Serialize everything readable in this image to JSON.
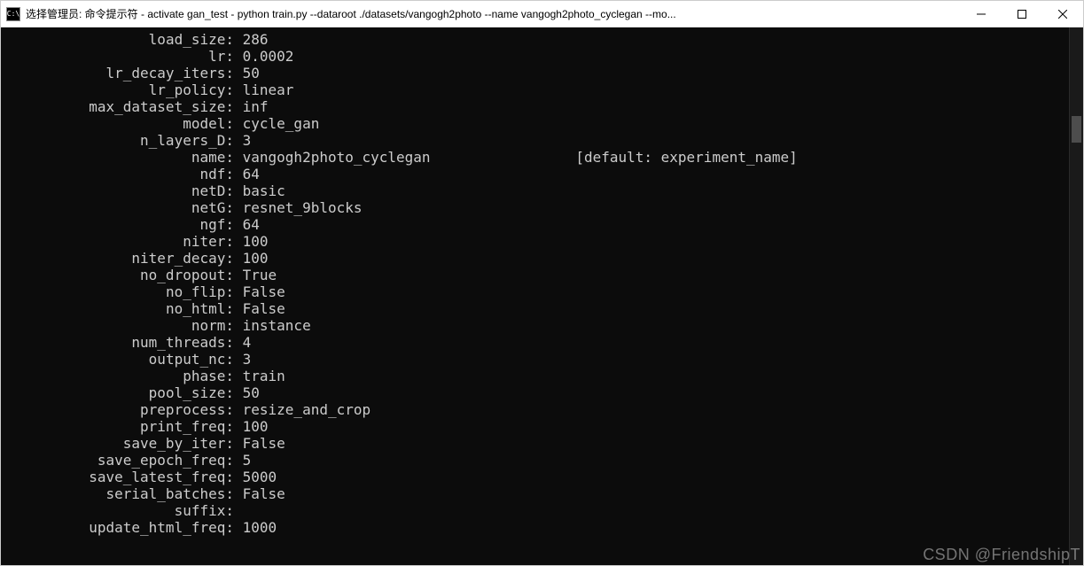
{
  "window": {
    "icon_text": "C:\\",
    "title": "选择管理员: 命令提示符 - activate  gan_test - python  train.py --dataroot ./datasets/vangogh2photo --name vangogh2photo_cyclegan --mo..."
  },
  "terminal": {
    "params": [
      {
        "key": "load_size",
        "value": "286",
        "extra": ""
      },
      {
        "key": "lr",
        "value": "0.0002",
        "extra": ""
      },
      {
        "key": "lr_decay_iters",
        "value": "50",
        "extra": ""
      },
      {
        "key": "lr_policy",
        "value": "linear",
        "extra": ""
      },
      {
        "key": "max_dataset_size",
        "value": "inf",
        "extra": ""
      },
      {
        "key": "model",
        "value": "cycle_gan",
        "extra": ""
      },
      {
        "key": "n_layers_D",
        "value": "3",
        "extra": ""
      },
      {
        "key": "name",
        "value": "vangogh2photo_cyclegan              \t[default: experiment_name]",
        "extra": ""
      },
      {
        "key": "ndf",
        "value": "64",
        "extra": ""
      },
      {
        "key": "netD",
        "value": "basic",
        "extra": ""
      },
      {
        "key": "netG",
        "value": "resnet_9blocks",
        "extra": ""
      },
      {
        "key": "ngf",
        "value": "64",
        "extra": ""
      },
      {
        "key": "niter",
        "value": "100",
        "extra": ""
      },
      {
        "key": "niter_decay",
        "value": "100",
        "extra": ""
      },
      {
        "key": "no_dropout",
        "value": "True",
        "extra": ""
      },
      {
        "key": "no_flip",
        "value": "False",
        "extra": ""
      },
      {
        "key": "no_html",
        "value": "False",
        "extra": ""
      },
      {
        "key": "norm",
        "value": "instance",
        "extra": ""
      },
      {
        "key": "num_threads",
        "value": "4",
        "extra": ""
      },
      {
        "key": "output_nc",
        "value": "3",
        "extra": ""
      },
      {
        "key": "phase",
        "value": "train",
        "extra": ""
      },
      {
        "key": "pool_size",
        "value": "50",
        "extra": ""
      },
      {
        "key": "preprocess",
        "value": "resize_and_crop",
        "extra": ""
      },
      {
        "key": "print_freq",
        "value": "100",
        "extra": ""
      },
      {
        "key": "save_by_iter",
        "value": "False",
        "extra": ""
      },
      {
        "key": "save_epoch_freq",
        "value": "5",
        "extra": ""
      },
      {
        "key": "save_latest_freq",
        "value": "5000",
        "extra": ""
      },
      {
        "key": "serial_batches",
        "value": "False",
        "extra": ""
      },
      {
        "key": "suffix",
        "value": "",
        "extra": ""
      },
      {
        "key": "update_html_freq",
        "value": "1000",
        "extra": ""
      }
    ]
  },
  "watermark": "CSDN @FriendshipT"
}
